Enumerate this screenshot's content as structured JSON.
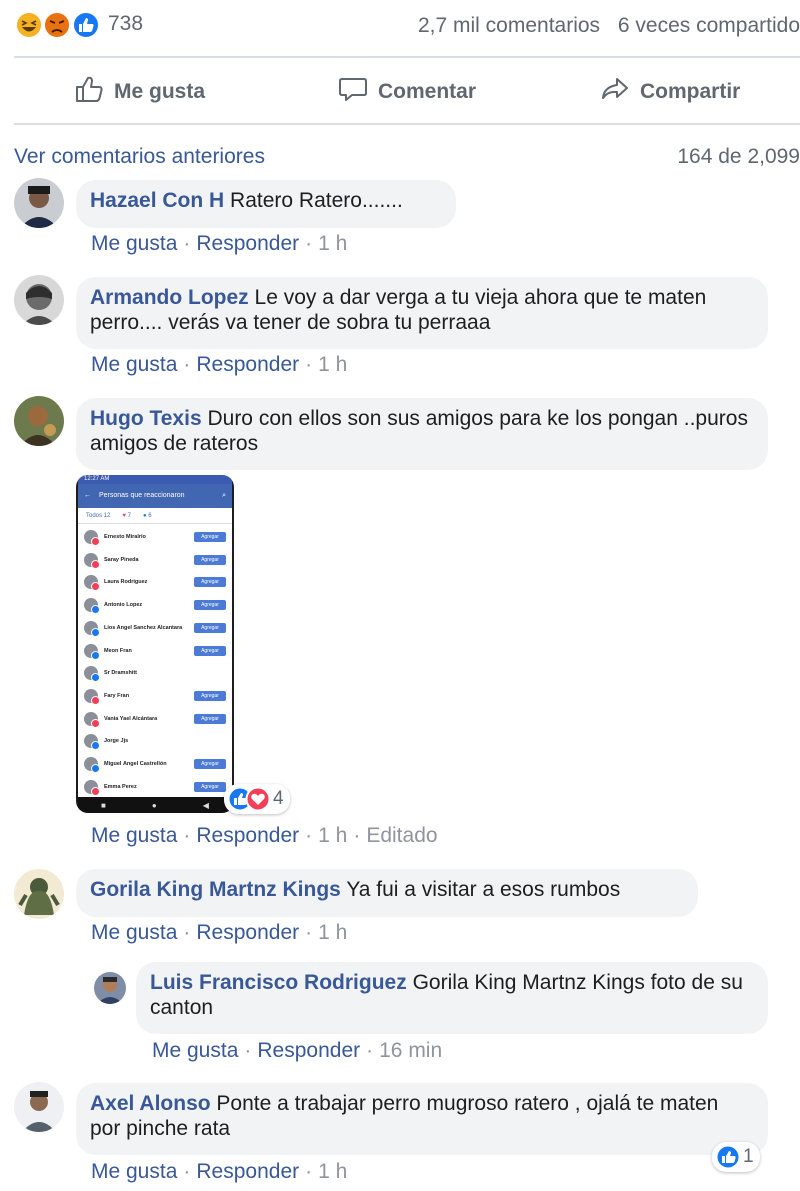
{
  "post_summary": {
    "reaction_count": "738",
    "reactions": [
      "haha-icon",
      "angry-icon",
      "like-icon"
    ],
    "comments": "2,7 mil comentarios",
    "shares": "6 veces compartido"
  },
  "actions": {
    "like": "Me gusta",
    "comment": "Comentar",
    "share": "Compartir"
  },
  "comments_header": {
    "view_previous": "Ver comentarios anteriores",
    "count": "164 de 2,099"
  },
  "comment_actions": {
    "like": "Me gusta",
    "reply": "Responder",
    "separator": "·",
    "edited": "Editado"
  },
  "comments": [
    {
      "author": "Hazael Con H",
      "text": "Ratero Ratero.......",
      "time": "1 h"
    },
    {
      "author": "Armando Lopez",
      "text": "Le voy a dar verga a tu vieja ahora que te maten perro.... verás va tener de sobra tu perraaa",
      "time": "1 h"
    },
    {
      "author": "Hugo Texis",
      "text": "Duro con ellos son sus amigos para ke los pongan ..puros amigos de rateros",
      "time": "1 h",
      "reaction_count": "4"
    },
    {
      "author": "Gorila King Martnz Kings",
      "text": "Ya fui a visitar a esos rumbos",
      "time": "1 h"
    },
    {
      "author": "Luis Francisco Rodriguez",
      "text": "Gorila King Martnz Kings foto de su canton",
      "time": "16 min"
    },
    {
      "author": "Axel Alonso",
      "text": "Ponte a trabajar perro mugroso ratero , ojalá te maten por pinche rata",
      "time": "1 h",
      "reaction_count": "1"
    }
  ],
  "attachment": {
    "time": "12:27 AM",
    "title": "Personas que reaccionaron",
    "tabs": [
      "Todos 12",
      "7",
      "6"
    ],
    "add_label": "Agregar",
    "people": [
      {
        "name": "Ernesto Miralrio",
        "badge": "#f33e58",
        "add": true
      },
      {
        "name": "Saray Pineda",
        "badge": "#f33e58",
        "add": true
      },
      {
        "name": "Laura Rodriguez",
        "badge": "#f33e58",
        "add": true
      },
      {
        "name": "Antonio Lopez",
        "badge": "#1877f2",
        "add": true
      },
      {
        "name": "Lios Angel Sanchez Alcantara",
        "badge": "#1877f2",
        "add": true
      },
      {
        "name": "Meon Fran",
        "badge": "#1877f2",
        "add": true
      },
      {
        "name": "Sr Dramshitt",
        "badge": "#1877f2",
        "add": false
      },
      {
        "name": "Fary Fran",
        "badge": "#f33e58",
        "add": true
      },
      {
        "name": "Vania Yael Alcántara",
        "badge": "#f33e58",
        "add": true
      },
      {
        "name": "Jorge Jjs",
        "badge": "#1877f2",
        "add": false
      },
      {
        "name": "Miguel Ángel Castrellón",
        "badge": "#1877f2",
        "add": true
      },
      {
        "name": "Emma Perez",
        "badge": "#f33e58",
        "add": true
      }
    ]
  },
  "colors": {
    "link": "#385898",
    "like_blue": "#1877f2",
    "love_red": "#f33e58",
    "haha_yellow": "#f7b125",
    "angry_orange": "#e9710f"
  }
}
